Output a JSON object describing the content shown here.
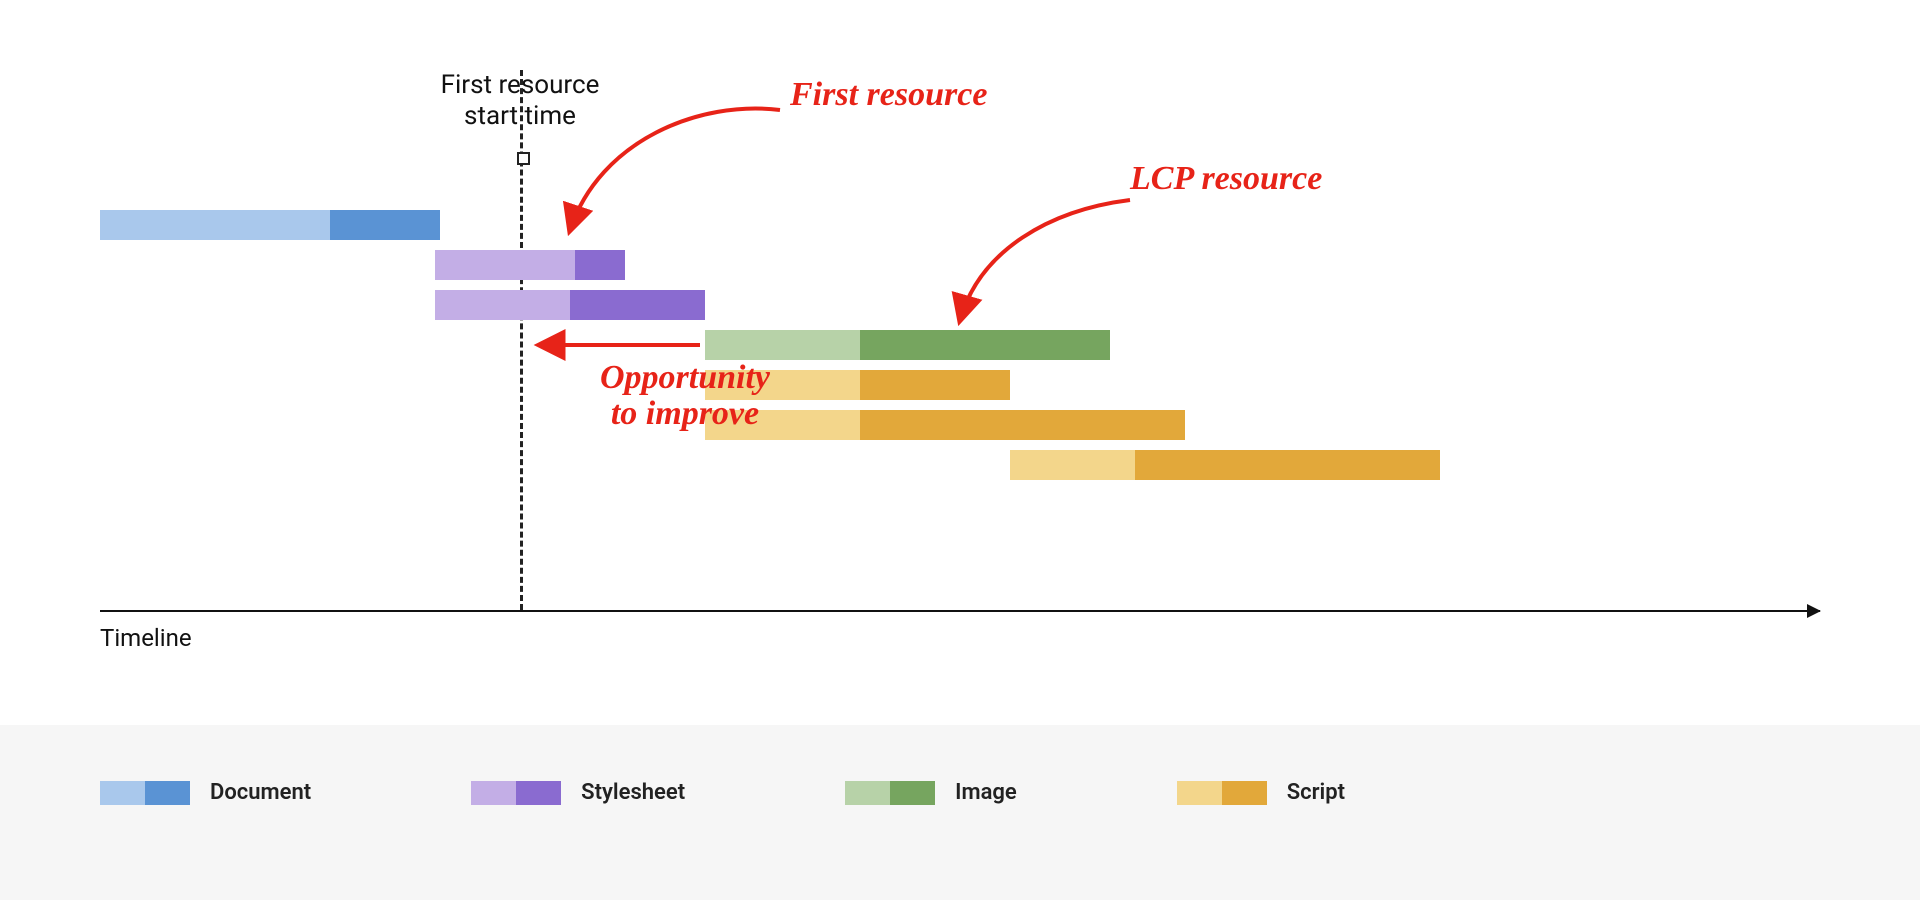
{
  "chart_data": {
    "type": "bar",
    "title": "",
    "xlabel": "Timeline",
    "ylabel": "",
    "marker_label": "First resource\nstart time",
    "marker_x": 320,
    "annotations": [
      {
        "text": "First resource",
        "target": "stylesheet-1"
      },
      {
        "text": "LCP resource",
        "target": "image-1"
      },
      {
        "text": "Opportunity to improve",
        "target": "gap"
      }
    ],
    "legend": [
      {
        "name": "Document",
        "type": "document"
      },
      {
        "name": "Stylesheet",
        "type": "stylesheet"
      },
      {
        "name": "Image",
        "type": "image"
      },
      {
        "name": "Script",
        "type": "script"
      }
    ],
    "series": [
      {
        "name": "document-1",
        "type": "document",
        "start": 0,
        "split": 230,
        "end": 340
      },
      {
        "name": "stylesheet-1",
        "type": "stylesheet",
        "start": 335,
        "split": 475,
        "end": 525
      },
      {
        "name": "stylesheet-2",
        "type": "stylesheet",
        "start": 335,
        "split": 470,
        "end": 605
      },
      {
        "name": "image-1",
        "type": "image",
        "start": 605,
        "split": 760,
        "end": 1010
      },
      {
        "name": "script-1",
        "type": "script",
        "start": 605,
        "split": 760,
        "end": 910
      },
      {
        "name": "script-2",
        "type": "script",
        "start": 605,
        "split": 760,
        "end": 1085
      },
      {
        "name": "script-3",
        "type": "script",
        "start": 910,
        "split": 1035,
        "end": 1340
      }
    ]
  },
  "labels": {
    "timeline": "Timeline",
    "marker_line1": "First resource",
    "marker_line2": "start time",
    "ann_first_resource": "First resource",
    "ann_lcp_resource": "LCP resource",
    "ann_opportunity_l1": "Opportunity",
    "ann_opportunity_l2": "to improve",
    "legend_document": "Document",
    "legend_stylesheet": "Stylesheet",
    "legend_image": "Image",
    "legend_script": "Script"
  }
}
